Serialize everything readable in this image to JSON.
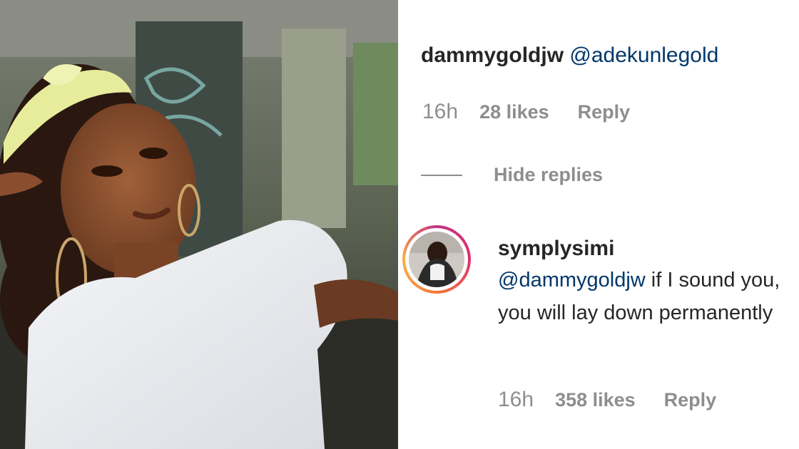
{
  "comment": {
    "username": "dammygoldjw",
    "mention": "@adekunlegold",
    "time": "16h",
    "likes": "28 likes",
    "reply_label": "Reply"
  },
  "thread": {
    "hide_replies_label": "Hide replies"
  },
  "reply": {
    "username": "symplysimi",
    "mention": "@dammygoldjw",
    "text": " if I sound you, you will lay down permanently",
    "time": "16h",
    "likes": "358 likes",
    "reply_label": "Reply"
  },
  "colors": {
    "username": "#262626",
    "mention": "#00376b",
    "meta": "#8e8e8e",
    "story_ring": "#e1306c"
  },
  "icons": [
    "hide-replies-line-icon",
    "avatar"
  ]
}
